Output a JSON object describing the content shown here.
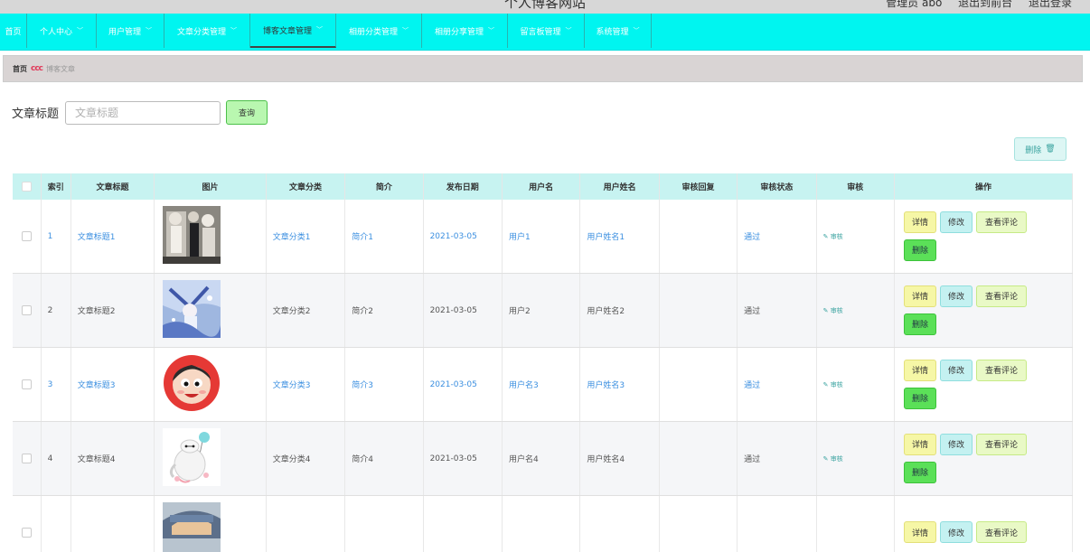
{
  "header": {
    "site_title": "个人博客网站",
    "admin_user": "管理员 abo",
    "goto_front": "退出到前台",
    "logout": "退出登录"
  },
  "nav": [
    {
      "label": "首页",
      "dropdown": false,
      "active": false
    },
    {
      "label": "个人中心",
      "dropdown": true,
      "active": false
    },
    {
      "label": "用户管理",
      "dropdown": true,
      "active": false
    },
    {
      "label": "文章分类管理",
      "dropdown": true,
      "active": false
    },
    {
      "label": "博客文章管理",
      "dropdown": true,
      "active": true
    },
    {
      "label": "相册分类管理",
      "dropdown": true,
      "active": false
    },
    {
      "label": "相册分享管理",
      "dropdown": true,
      "active": false
    },
    {
      "label": "留言板管理",
      "dropdown": true,
      "active": false
    },
    {
      "label": "系统管理",
      "dropdown": true,
      "active": false
    }
  ],
  "breadcrumb": {
    "home": "首页",
    "separator": "ccc",
    "current": "博客文章"
  },
  "search": {
    "label": "文章标题",
    "placeholder": "文章标题",
    "button": "查询"
  },
  "toolbar": {
    "delete_label": "删除"
  },
  "table": {
    "headers": [
      "索引",
      "文章标题",
      "图片",
      "文章分类",
      "简介",
      "发布日期",
      "用户名",
      "用户姓名",
      "审核回复",
      "审核状态",
      "审核",
      "操作"
    ],
    "review_label": "审核",
    "actions": {
      "detail": "详情",
      "edit": "修改",
      "comments": "查看评论",
      "delete": "删除"
    },
    "rows": [
      {
        "index": "1",
        "title": "文章标题1",
        "image": "anime-characters",
        "category": "文章分类1",
        "intro": "简介1",
        "date": "2021-03-05",
        "username": "用户1",
        "realname": "用户姓名1",
        "reply": "",
        "status": "通过",
        "linked": true
      },
      {
        "index": "2",
        "title": "文章标题2",
        "image": "anime-winter",
        "category": "文章分类2",
        "intro": "简介2",
        "date": "2021-03-05",
        "username": "用户2",
        "realname": "用户姓名2",
        "reply": "",
        "status": "通过",
        "linked": false
      },
      {
        "index": "3",
        "title": "文章标题3",
        "image": "crayon-shin-chan",
        "category": "文章分类3",
        "intro": "简介3",
        "date": "2021-03-05",
        "username": "用户名3",
        "realname": "用户姓名3",
        "reply": "",
        "status": "通过",
        "linked": true
      },
      {
        "index": "4",
        "title": "文章标题4",
        "image": "baymax",
        "category": "文章分类4",
        "intro": "简介4",
        "date": "2021-03-05",
        "username": "用户名4",
        "realname": "用户姓名4",
        "reply": "",
        "status": "通过",
        "linked": false
      },
      {
        "index": "",
        "title": "",
        "image": "anime-portrait",
        "category": "",
        "intro": "",
        "date": "",
        "username": "",
        "realname": "",
        "reply": "",
        "status": "",
        "linked": false
      }
    ]
  }
}
